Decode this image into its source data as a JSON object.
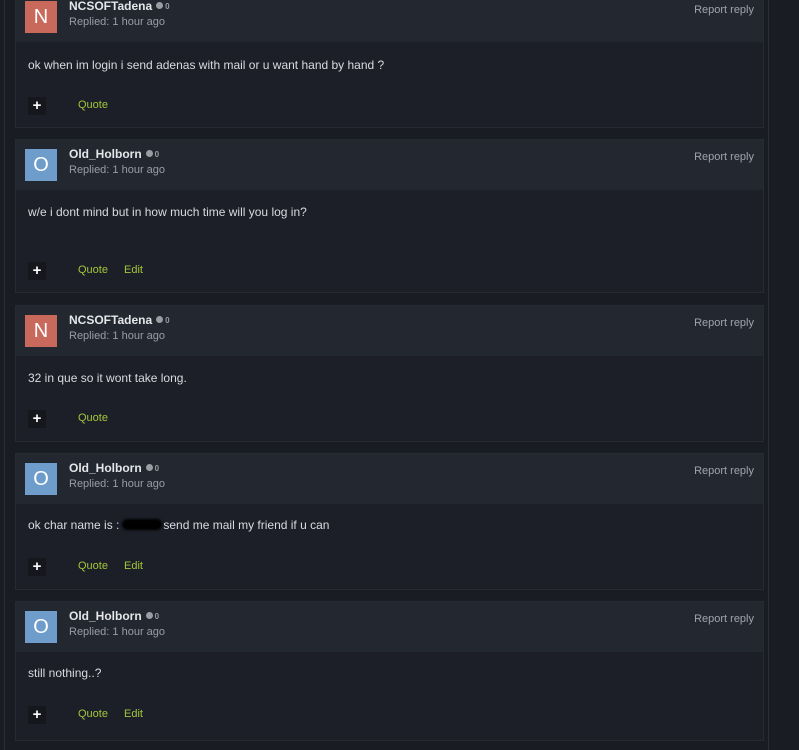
{
  "posts": [
    {
      "initial": "N",
      "avatar_color": "#c9695c",
      "author": "NCSOFTadena",
      "reputation": "0",
      "meta": "Replied: 1 hour ago",
      "report_label": "Report reply",
      "body": "ok when im login i send adenas with mail or u want hand by hand ?",
      "quote_label": "Quote"
    },
    {
      "initial": "O",
      "avatar_color": "#6e9ccb",
      "author": "Old_Holborn",
      "reputation": "0",
      "meta": "Replied: 1 hour ago",
      "report_label": "Report reply",
      "body": "w/e i dont mind but in how much time will you log in?",
      "quote_label": "Quote",
      "edit_label": "Edit"
    },
    {
      "initial": "N",
      "avatar_color": "#c9695c",
      "author": "NCSOFTadena",
      "reputation": "0",
      "meta": "Replied: 1 hour ago",
      "report_label": "Report reply",
      "body": "32 in que so it wont take long.",
      "quote_label": "Quote"
    },
    {
      "initial": "O",
      "avatar_color": "#6e9ccb",
      "author": "Old_Holborn",
      "reputation": "0",
      "meta": "Replied: 1 hour ago",
      "report_label": "Report reply",
      "body_before": "ok char name is :",
      "body_after": "send me mail my friend if u can",
      "quote_label": "Quote",
      "edit_label": "Edit"
    },
    {
      "initial": "O",
      "avatar_color": "#6e9ccb",
      "author": "Old_Holborn",
      "reputation": "0",
      "meta": "Replied: 1 hour ago",
      "report_label": "Report reply",
      "body": "still nothing..?",
      "quote_label": "Quote",
      "edit_label": "Edit"
    }
  ],
  "plus_glyph": "+",
  "colors": {
    "page_bg": "#1a1c24",
    "post_bg": "#1c1f27",
    "header_bg": "#232730",
    "link_green": "#a1c53a"
  }
}
